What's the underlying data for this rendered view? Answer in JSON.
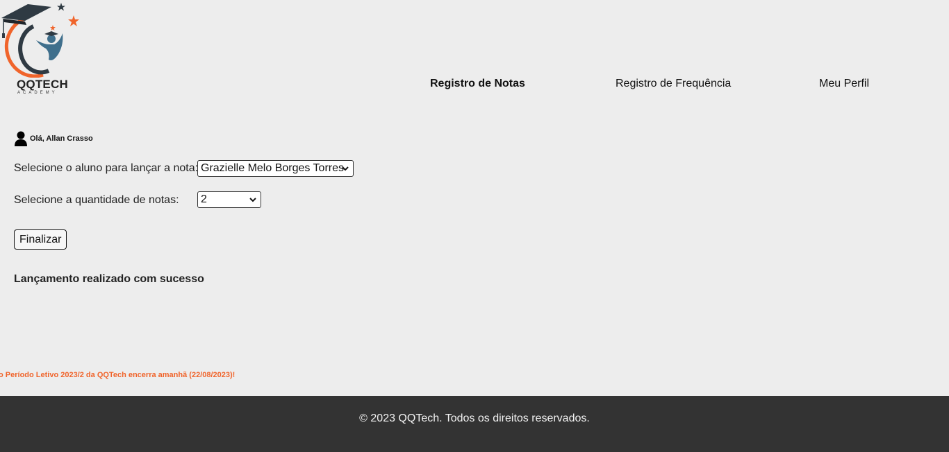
{
  "header": {
    "logo": {
      "name": "QQTECH",
      "tagline": "ACADEMY"
    },
    "nav": [
      {
        "label": "Registro de Notas",
        "active": true
      },
      {
        "label": "Registro de Frequência",
        "active": false
      },
      {
        "label": "Meu Perfil",
        "active": false
      }
    ]
  },
  "user": {
    "icon": "user-icon",
    "greeting": "Olá, Allan Crasso"
  },
  "form": {
    "aluno_label": "Selecione o aluno para lançar a nota:",
    "aluno_selected": "Grazielle Melo Borges Torres",
    "quantidade_label": "Selecione a quantidade de notas:",
    "quantidade_selected": "2",
    "submit_label": "Finalizar"
  },
  "status": {
    "message": "Lançamento realizado com sucesso"
  },
  "notice": {
    "text": "o Período Letivo 2023/2 da QQTech encerra amanhã (22/08/2023)!",
    "color": "#f0642b"
  },
  "footer": {
    "text": "© 2023 QQTech. Todos os direitos reservados."
  },
  "colors": {
    "background": "#ededed",
    "footer": "#333333",
    "accent": "#f0642b",
    "logo_dark": "#2f3a43",
    "logo_blue": "#3f6f8c"
  }
}
